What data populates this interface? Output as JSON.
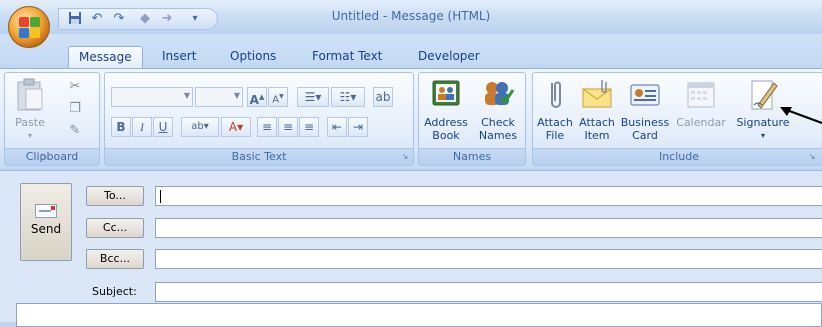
{
  "window": {
    "title": "Untitled - Message (HTML)"
  },
  "qat": {
    "items": [
      "save-icon",
      "undo-icon",
      "redo-icon",
      "up-icon",
      "down-icon",
      "customize-icon"
    ]
  },
  "tabs": [
    {
      "label": "Message",
      "active": true
    },
    {
      "label": "Insert",
      "active": false
    },
    {
      "label": "Options",
      "active": false
    },
    {
      "label": "Format Text",
      "active": false
    },
    {
      "label": "Developer",
      "active": false
    }
  ],
  "ribbon": {
    "clipboard": {
      "label": "Clipboard",
      "paste": "Paste"
    },
    "basic_text": {
      "label": "Basic Text"
    },
    "names": {
      "label": "Names",
      "address_book": "Address Book",
      "check_names": "Check Names"
    },
    "include": {
      "label": "Include",
      "attach_file": "Attach File",
      "attach_item": "Attach Item",
      "business_card": "Business Card",
      "calendar": "Calendar",
      "signature": "Signature"
    }
  },
  "compose": {
    "send": "Send",
    "to": "To...",
    "cc": "Cc...",
    "bcc": "Bcc...",
    "subject": "Subject:",
    "to_value": "",
    "cc_value": "",
    "bcc_value": "",
    "subject_value": ""
  },
  "colors": {
    "accent": "#15428b",
    "ribbon_bg": "#dce8f8",
    "office_orange": "#f3a638"
  }
}
